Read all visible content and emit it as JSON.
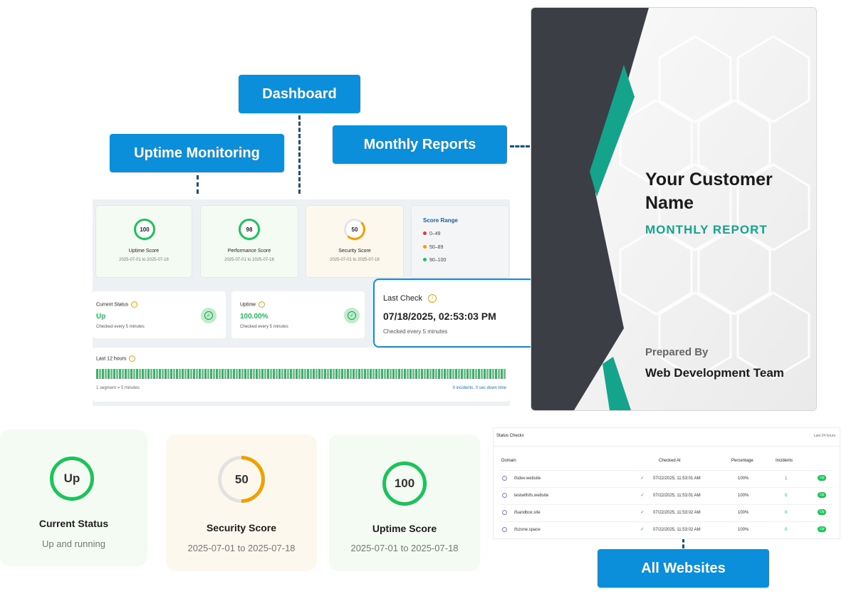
{
  "callouts": {
    "dashboard": "Dashboard",
    "uptime_monitoring": "Uptime Monitoring",
    "monthly_reports": "Monthly Reports",
    "all_websites": "All Websites"
  },
  "score_cards": [
    {
      "value": "100",
      "title": "Uptime Score",
      "dates": "2025-07-01 to 2025-07-18"
    },
    {
      "value": "98",
      "title": "Performance Score",
      "dates": "2025-07-01 to 2025-07-18"
    },
    {
      "value": "50",
      "title": "Security Score",
      "dates": "2025-07-01 to 2025-07-18"
    }
  ],
  "score_range": {
    "title": "Score Range",
    "items": [
      {
        "label": "0–49",
        "color": "#e53935"
      },
      {
        "label": "50–89",
        "color": "#f0a000"
      },
      {
        "label": "90–100",
        "color": "#1ec25a"
      }
    ]
  },
  "current_status": {
    "label": "Current Status",
    "value": "Up",
    "note": "Checked every 5 minutes"
  },
  "uptime": {
    "label": "Uptime",
    "value": "100.00%",
    "note": "Checked every 5 minutes"
  },
  "last_12": {
    "label": "Last 12 hours",
    "segment_note": "1 segment = 5 minutes",
    "incidents_note": "0 incidents, 0 sec down time",
    "segments": 144
  },
  "last_check": {
    "label": "Last Check",
    "value": "07/18/2025, 02:53:03 PM",
    "note": "Checked every 5 minutes"
  },
  "report_cover": {
    "customer": "Your Customer Name",
    "subtitle": "MONTHLY REPORT",
    "prepared_label": "Prepared By",
    "prepared_by": "Web Development Team"
  },
  "bottom_cards": [
    {
      "ring": "Up",
      "title": "Current Status",
      "sub": "Up and running",
      "fraction": 1.0
    },
    {
      "ring": "50",
      "title": "Security Score",
      "sub": "2025-07-01 to 2025-07-18",
      "fraction": 0.5
    },
    {
      "ring": "100",
      "title": "Uptime Score",
      "sub": "2025-07-01 to 2025-07-18",
      "fraction": 1.0
    }
  ],
  "status_checks": {
    "title": "Status Checks",
    "range": "Last 24 hours",
    "headers": [
      "Domain",
      "Checked At",
      "Percentage",
      "Incidents"
    ],
    "rows": [
      {
        "domain": "ifsdev.website",
        "checked": "07/22/2025, 11:53:01 AM",
        "pct": "100%",
        "incidents": "1",
        "status": "Up"
      },
      {
        "domain": "testwithifs.website",
        "checked": "07/22/2025, 11:53:01 AM",
        "pct": "100%",
        "incidents": "0",
        "status": "Up"
      },
      {
        "domain": "ifsandbox.site",
        "checked": "07/22/2025, 11:53:02 AM",
        "pct": "100%",
        "incidents": "0",
        "status": "Up"
      },
      {
        "domain": "ifszone.space",
        "checked": "07/22/2025, 11:53:02 AM",
        "pct": "100%",
        "incidents": "0",
        "status": "Up"
      }
    ]
  },
  "colors": {
    "accent": "#0b8fda",
    "green": "#1ec25a",
    "amber": "#f0a000",
    "teal": "#14a38b",
    "dark": "#3b3f45"
  }
}
